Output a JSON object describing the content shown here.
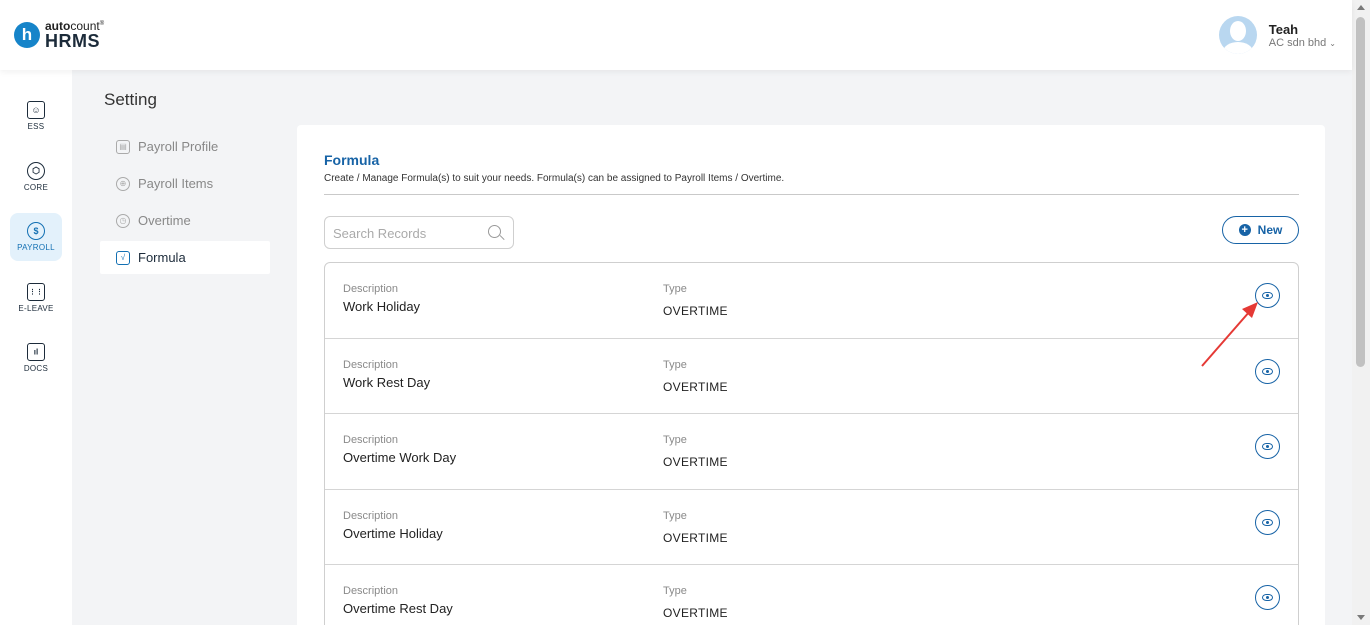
{
  "header": {
    "logo_badge": "h",
    "logo_top_bold": "auto",
    "logo_top_light": "count",
    "logo_top_mark": "®",
    "logo_main": "HRMS",
    "user_name": "Teah",
    "user_org": "AC sdn bhd",
    "user_org_chevron": "⌄"
  },
  "rail": {
    "items": [
      {
        "label": "ESS",
        "icon": "ess-icon",
        "glyph": "☺"
      },
      {
        "label": "CORE",
        "icon": "core-icon",
        "glyph": "⬡"
      },
      {
        "label": "PAYROLL",
        "icon": "payroll-icon",
        "glyph": "$"
      },
      {
        "label": "E-LEAVE",
        "icon": "calendar-icon",
        "glyph": "⋮⋮"
      },
      {
        "label": "DOCS",
        "icon": "docs-icon",
        "glyph": "ıl"
      }
    ],
    "active": "PAYROLL"
  },
  "settings": {
    "title": "Setting",
    "menu": [
      {
        "label": "Payroll Profile",
        "icon": "payroll-profile-icon",
        "glyph": "▤"
      },
      {
        "label": "Payroll Items",
        "icon": "payroll-items-icon",
        "glyph": "⊕"
      },
      {
        "label": "Overtime",
        "icon": "overtime-icon",
        "glyph": "◷"
      },
      {
        "label": "Formula",
        "icon": "formula-icon",
        "glyph": "√"
      }
    ],
    "active": "Formula"
  },
  "formula": {
    "title": "Formula",
    "subtitle": "Create / Manage Formula(s) to suit your needs. Formula(s) can be assigned to Payroll Items / Overtime.",
    "search_placeholder": "Search Records",
    "new_label": "New",
    "new_icon": "+",
    "description_label": "Description",
    "type_label": "Type",
    "rows": [
      {
        "description": "Work Holiday",
        "type": "OVERTIME"
      },
      {
        "description": "Work Rest Day",
        "type": "OVERTIME"
      },
      {
        "description": "Overtime Work Day",
        "type": "OVERTIME"
      },
      {
        "description": "Overtime Holiday",
        "type": "OVERTIME"
      },
      {
        "description": "Overtime Rest Day",
        "type": "OVERTIME"
      }
    ]
  },
  "colors": {
    "brand": "#1684c9",
    "accent": "#1763a6",
    "annotation_arrow": "#e53935"
  }
}
